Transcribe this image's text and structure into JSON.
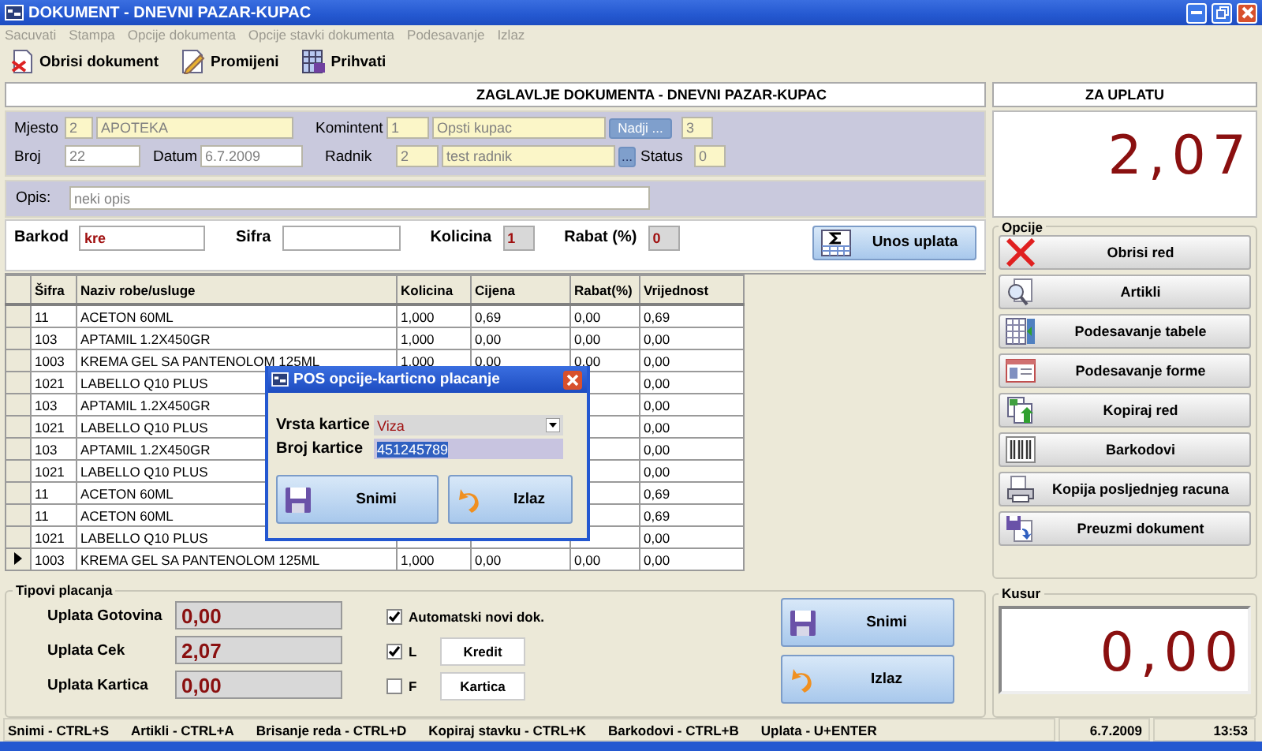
{
  "window": {
    "title": "DOKUMENT - DNEVNI PAZAR-KUPAC"
  },
  "menu": [
    {
      "label": "Sacuvati",
      "disabled": true
    },
    {
      "label": "Stampa",
      "disabled": true
    },
    {
      "label": "Opcije dokumenta",
      "disabled": true
    },
    {
      "label": "Opcije stavki dokumenta",
      "disabled": true
    },
    {
      "label": "Podesavanje",
      "disabled": true
    },
    {
      "label": "Izlaz",
      "disabled": true
    }
  ],
  "toolbar": [
    {
      "label": "Obrisi dokument",
      "kind": "delete"
    },
    {
      "label": "Promijeni",
      "kind": "edit"
    },
    {
      "label": "Prihvati",
      "kind": "accept"
    }
  ],
  "header": {
    "title": "ZAGLAVLJE DOKUMENTA - DNEVNI PAZAR-KUPAC"
  },
  "document": {
    "mjesto": {
      "label": "Mjesto",
      "code": "2",
      "name": "APOTEKA"
    },
    "broj": {
      "label": "Broj",
      "value": "22"
    },
    "datum": {
      "label": "Datum",
      "value": "6.7.2009"
    },
    "komintent": {
      "label": "Komintent",
      "code": "1",
      "name": "Opsti kupac",
      "button": "Nadji ...",
      "extra": "3"
    },
    "radnik": {
      "label": "Radnik",
      "code": "2",
      "name": "test radnik",
      "button": "..."
    },
    "status": {
      "label": "Status",
      "value": "0"
    },
    "opis": {
      "label": "Opis:",
      "value": "neki opis"
    }
  },
  "entry": {
    "barkod": {
      "label": "Barkod",
      "value": "kre"
    },
    "sifra": {
      "label": "Sifra"
    },
    "kolicina": {
      "label": "Kolicina",
      "value": "1"
    },
    "rabat": {
      "label": "Rabat (%)",
      "value": "0"
    },
    "button": "Unos uplata"
  },
  "table": {
    "columns": [
      "Šifra",
      "Naziv robe/usluge",
      "Kolicina",
      "Cijena",
      "Rabat(%)",
      "Vrijednost"
    ],
    "rows": [
      {
        "current": false,
        "sifra": "11",
        "naziv": "ACETON 60ML",
        "kolicina": "1,000",
        "cijena": "0,69",
        "rabat": "0,00",
        "vrijednost": "0,69"
      },
      {
        "current": false,
        "sifra": "103",
        "naziv": "APTAMIL 1.2X450GR",
        "kolicina": "1,000",
        "cijena": "0,00",
        "rabat": "0,00",
        "vrijednost": "0,00"
      },
      {
        "current": false,
        "sifra": "1003",
        "naziv": "KREMA GEL SA PANTENOLOM 125ML",
        "kolicina": "1,000",
        "cijena": "0,00",
        "rabat": "0,00",
        "vrijednost": "0,00"
      },
      {
        "current": false,
        "sifra": "1021",
        "naziv": "LABELLO Q10 PLUS",
        "vrijednost": "0,00"
      },
      {
        "current": false,
        "sifra": "103",
        "naziv": "APTAMIL 1.2X450GR",
        "vrijednost": "0,00"
      },
      {
        "current": false,
        "sifra": "1021",
        "naziv": "LABELLO Q10 PLUS",
        "vrijednost": "0,00"
      },
      {
        "current": false,
        "sifra": "103",
        "naziv": "APTAMIL 1.2X450GR",
        "vrijednost": "0,00"
      },
      {
        "current": false,
        "sifra": "1021",
        "naziv": "LABELLO Q10 PLUS",
        "vrijednost": "0,00"
      },
      {
        "current": false,
        "sifra": "11",
        "naziv": "ACETON 60ML",
        "vrijednost": "0,69"
      },
      {
        "current": false,
        "sifra": "11",
        "naziv": "ACETON 60ML",
        "vrijednost": "0,69"
      },
      {
        "current": false,
        "sifra": "1021",
        "naziv": "LABELLO Q10 PLUS",
        "vrijednost": "0,00"
      },
      {
        "current": true,
        "sifra": "1003",
        "naziv": "KREMA GEL SA PANTENOLOM 125ML",
        "kolicina": "1,000",
        "cijena": "0,00",
        "rabat": "0,00",
        "vrijednost": "0,00"
      }
    ]
  },
  "dialog": {
    "title": "POS opcije-karticno placanje",
    "fields": [
      {
        "label": "Vrsta kartice",
        "value": "Viza",
        "kind": "select",
        "highlighted": false
      },
      {
        "label": "Broj kartice",
        "value": "451245789",
        "kind": "text",
        "highlighted": true
      }
    ],
    "buttons": [
      {
        "label": "Snimi",
        "kind": "save"
      },
      {
        "label": "Izlaz",
        "kind": "exit"
      }
    ]
  },
  "za_uplatu": {
    "title": "ZA UPLATU",
    "amount": "2,07"
  },
  "options": {
    "title": "Opcije",
    "buttons": [
      {
        "label": "Obrisi red",
        "kind": "delete"
      },
      {
        "label": "Artikli",
        "kind": "search"
      },
      {
        "label": "Podesavanje tabele",
        "kind": "table"
      },
      {
        "label": "Podesavanje forme",
        "kind": "form"
      },
      {
        "label": "Kopiraj red",
        "kind": "copy"
      },
      {
        "label": "Barkodovi",
        "kind": "barcode"
      },
      {
        "label": "Kopija posljednjeg racuna",
        "kind": "print"
      },
      {
        "label": "Preuzmi dokument",
        "kind": "import"
      }
    ]
  },
  "payments": {
    "title": "Tipovi placanja",
    "rows": [
      {
        "label": "Uplata Gotovina",
        "value": "0,00"
      },
      {
        "label": "Uplata Cek",
        "value": "2,07"
      },
      {
        "label": "Uplata Kartica",
        "value": "0,00"
      }
    ],
    "checks": [
      {
        "label": "Automatski novi dok.",
        "checked": true
      },
      {
        "label": "L",
        "checked": true,
        "button": "Kredit"
      },
      {
        "label": "F",
        "checked": false,
        "button": "Kartica"
      }
    ],
    "buttons": [
      {
        "label": "Snimi",
        "kind": "save"
      },
      {
        "label": "Izlaz",
        "kind": "exit"
      }
    ]
  },
  "kusur": {
    "title": "Kusur",
    "amount": "0,00"
  },
  "status_bar": {
    "shortcuts": [
      "Snimi - CTRL+S",
      "Artikli - CTRL+A",
      "Brisanje reda - CTRL+D",
      "Kopiraj stavku - CTRL+K",
      "Barkodovi - CTRL+B",
      "Uplata - U+ENTER"
    ],
    "date": "6.7.2009",
    "time": "13:53"
  }
}
